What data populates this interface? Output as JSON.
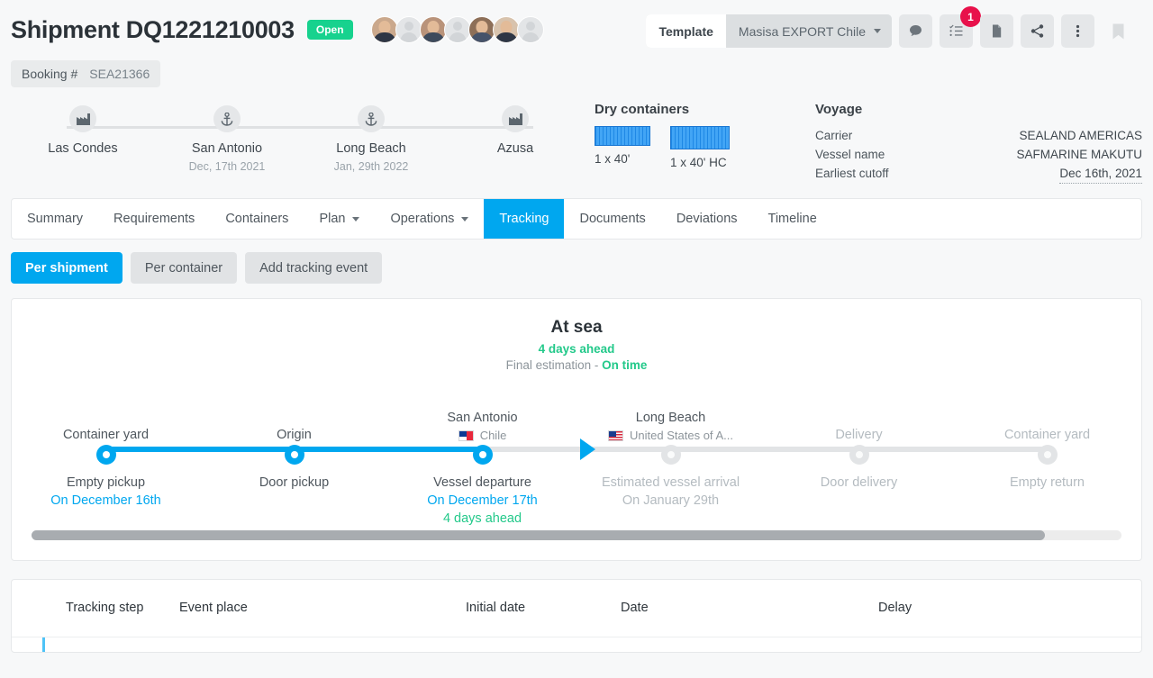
{
  "header": {
    "title": "Shipment DQ1221210003",
    "status_badge": "Open",
    "booking_label": "Booking #",
    "booking_value": "SEA21366",
    "avatars": [
      {
        "name": "avatar-user-1",
        "type": "photo"
      },
      {
        "name": "avatar-user-2",
        "type": "placeholder"
      },
      {
        "name": "avatar-user-3",
        "type": "photo"
      },
      {
        "name": "avatar-user-4",
        "type": "placeholder"
      },
      {
        "name": "avatar-user-5",
        "type": "photo"
      },
      {
        "name": "avatar-user-6",
        "type": "photo"
      },
      {
        "name": "avatar-user-7",
        "type": "placeholder"
      }
    ]
  },
  "toolbar": {
    "template_label": "Template",
    "template_value": "Masisa EXPORT Chile",
    "icons": [
      {
        "name": "comment-icon",
        "label": "comment"
      },
      {
        "name": "checklist-icon",
        "label": "checklist",
        "badge": "1"
      },
      {
        "name": "document-icon",
        "label": "document"
      },
      {
        "name": "share-icon",
        "label": "share"
      },
      {
        "name": "kebab-menu-icon",
        "label": "more"
      },
      {
        "name": "bookmark-icon",
        "label": "bookmark"
      }
    ],
    "checklist_badge": "1"
  },
  "route": {
    "steps": [
      {
        "place": "Las Condes",
        "date": "",
        "icon": "factory-icon"
      },
      {
        "place": "San Antonio",
        "date": "Dec, 17th 2021",
        "icon": "anchor-icon"
      },
      {
        "place": "Long Beach",
        "date": "Jan, 29th 2022",
        "icon": "anchor-icon"
      },
      {
        "place": "Azusa",
        "date": "",
        "icon": "factory-icon"
      }
    ]
  },
  "containers": {
    "title": "Dry containers",
    "items": [
      {
        "label": "1 x 40'",
        "size": "40"
      },
      {
        "label": "1 x 40' HC",
        "size": "40hc"
      }
    ],
    "color": "#2196f3"
  },
  "voyage": {
    "title": "Voyage",
    "rows": [
      {
        "key": "Carrier",
        "value": "SEALAND AMERICAS",
        "dotted": false
      },
      {
        "key": "Vessel name",
        "value": "SAFMARINE MAKUTU",
        "dotted": false
      },
      {
        "key": "Earliest cutoff",
        "value": "Dec 16th, 2021",
        "dotted": true
      }
    ]
  },
  "tabs": [
    {
      "label": "Summary",
      "active": false,
      "caret": false
    },
    {
      "label": "Requirements",
      "active": false,
      "caret": false
    },
    {
      "label": "Containers",
      "active": false,
      "caret": false
    },
    {
      "label": "Plan",
      "active": false,
      "caret": true
    },
    {
      "label": "Operations",
      "active": false,
      "caret": true
    },
    {
      "label": "Tracking",
      "active": true,
      "caret": false
    },
    {
      "label": "Documents",
      "active": false,
      "caret": false
    },
    {
      "label": "Deviations",
      "active": false,
      "caret": false
    },
    {
      "label": "Timeline",
      "active": false,
      "caret": false
    }
  ],
  "subtabs": [
    {
      "label": "Per shipment",
      "active": true
    },
    {
      "label": "Per container",
      "active": false
    },
    {
      "label": "Add tracking event",
      "active": false
    }
  ],
  "tracking": {
    "status_title": "At sea",
    "status_sub": "4 days ahead",
    "final_prefix": "Final estimation - ",
    "final_value": "On time",
    "steps": [
      {
        "place": "Container yard",
        "country": "",
        "flag": "",
        "event": "Empty pickup",
        "date": "On December 16th",
        "ahead": "",
        "done": true,
        "place_muted": false
      },
      {
        "place": "Origin",
        "country": "",
        "flag": "",
        "event": "Door pickup",
        "date": "",
        "ahead": "",
        "done": true,
        "place_muted": false
      },
      {
        "place": "San Antonio",
        "country": "Chile",
        "flag": "cl",
        "event": "Vessel departure",
        "date": "On December 17th",
        "ahead": "4 days ahead",
        "done": true,
        "place_muted": false
      },
      {
        "place": "Long Beach",
        "country": "United States of A...",
        "flag": "us",
        "event": "Estimated vessel arrival",
        "date": "On January 29th",
        "ahead": "",
        "done": false,
        "place_muted": false
      },
      {
        "place": "Delivery",
        "country": "",
        "flag": "",
        "event": "Door delivery",
        "date": "",
        "ahead": "",
        "done": false,
        "place_muted": true
      },
      {
        "place": "Container yard",
        "country": "",
        "flag": "",
        "event": "Empty return",
        "date": "",
        "ahead": "",
        "done": false,
        "place_muted": true
      }
    ]
  },
  "table": {
    "columns": [
      "Tracking step",
      "Event place",
      "Initial date",
      "Date",
      "Delay"
    ]
  },
  "colors": {
    "accent": "#00a7ef",
    "green": "#23c98a",
    "badge_red": "#e8114b",
    "muted": "#b4bbc0"
  }
}
